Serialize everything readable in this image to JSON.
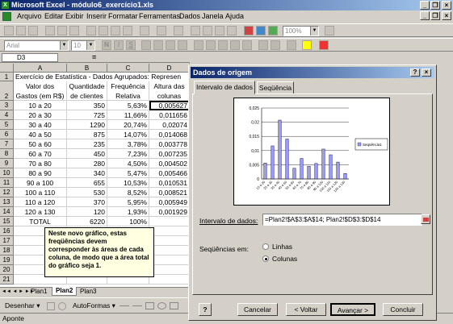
{
  "window": {
    "title": "Microsoft Excel - módulo6_exercício1.xls",
    "min": "_",
    "restore": "❐",
    "close": "×"
  },
  "menu": [
    "Arquivo",
    "Editar",
    "Exibir",
    "Inserir",
    "Formatar",
    "Ferramentas",
    "Dados",
    "Janela",
    "Ajuda"
  ],
  "toolbar": {
    "font": "Arial",
    "size": "10",
    "bold": "N",
    "italic": "I",
    "underline": "S",
    "zoom": "100%"
  },
  "formula_bar": {
    "cell": "D3",
    "eq": "="
  },
  "sheet": {
    "columns": [
      "A",
      "B",
      "C",
      "D"
    ],
    "title_row": "Exercício de Estatística - Dados Agrupados: Represen",
    "headers": {
      "a": [
        "Valor dos",
        "Gastos (em R$)"
      ],
      "b": [
        "Quantidade",
        "de clientes"
      ],
      "c": [
        "Frequência",
        "Relativa"
      ],
      "d": [
        "Altura das",
        "colunas"
      ]
    },
    "rows": [
      {
        "n": "3",
        "a": "10 a 20",
        "b": "350",
        "c": "5,63%",
        "d": "0,005627"
      },
      {
        "n": "4",
        "a": "20 a 30",
        "b": "725",
        "c": "11,66%",
        "d": "0,011656"
      },
      {
        "n": "5",
        "a": "30 a 40",
        "b": "1290",
        "c": "20,74%",
        "d": "0,02074"
      },
      {
        "n": "6",
        "a": "40 a 50",
        "b": "875",
        "c": "14,07%",
        "d": "0,014068"
      },
      {
        "n": "7",
        "a": "50 a 60",
        "b": "235",
        "c": "3,78%",
        "d": "0,003778"
      },
      {
        "n": "8",
        "a": "60 a 70",
        "b": "450",
        "c": "7,23%",
        "d": "0,007235"
      },
      {
        "n": "9",
        "a": "70 a 80",
        "b": "280",
        "c": "4,50%",
        "d": "0,004502"
      },
      {
        "n": "10",
        "a": "80 a 90",
        "b": "340",
        "c": "5,47%",
        "d": "0,005466"
      },
      {
        "n": "11",
        "a": "90 a 100",
        "b": "655",
        "c": "10,53%",
        "d": "0,010531"
      },
      {
        "n": "12",
        "a": "100 a 110",
        "b": "530",
        "c": "8,52%",
        "d": "0,008521"
      },
      {
        "n": "13",
        "a": "110 a 120",
        "b": "370",
        "c": "5,95%",
        "d": "0,005949"
      },
      {
        "n": "14",
        "a": "120 a 130",
        "b": "120",
        "c": "1,93%",
        "d": "0,001929"
      }
    ],
    "total_row": {
      "n": "15",
      "a": "TOTAL",
      "b": "6220",
      "c": "100%"
    },
    "empty_rows": [
      "16",
      "17",
      "18",
      "19",
      "20",
      "21"
    ],
    "row_numbers": {
      "r1": "1",
      "r2": "2"
    },
    "comment": "Neste novo gráfico, estas freqüências devem corresponder às áreas de cada coluna, de modo que a área total do gráfico seja 1.",
    "tabs": [
      "Plan1",
      "Plan2",
      "Plan3"
    ],
    "tab_nav": "◄◄ ◄ ► ►►"
  },
  "drawbar": {
    "draw": "Desenhar ▾",
    "autoformas": "AutoFormas ▾"
  },
  "status": "Aponte",
  "dialog": {
    "title": "Dados de origem",
    "help": "?",
    "close": "×",
    "tabs": [
      "Intervalo de dados",
      "Seqüência"
    ],
    "range_label": "Intervalo de dados:",
    "range_value": "=Plan2!$A$3:$A$14; Plan2!$D$3:$D$14",
    "series_in_label": "Seqüências em:",
    "radio_rows": "Linhas",
    "radio_cols": "Colunas",
    "buttons": {
      "help": "?",
      "cancel": "Cancelar",
      "back": "< Voltar",
      "next": "Avançar >",
      "finish": "Concluir"
    }
  },
  "chart_data": {
    "type": "bar",
    "categories": [
      "10 a 20",
      "20 a 30",
      "30 a 40",
      "40 a 50",
      "50 a 60",
      "60 a 70",
      "70 a 80",
      "80 a 90",
      "90 a 100",
      "100 a 110",
      "110 a 120",
      "120 a 130"
    ],
    "series": [
      {
        "name": "Seqüência1",
        "values": [
          0.005627,
          0.011656,
          0.02074,
          0.014068,
          0.003778,
          0.007235,
          0.004502,
          0.005466,
          0.010531,
          0.008521,
          0.005949,
          0.001929
        ]
      }
    ],
    "yticks": [
      "0",
      "0,005",
      "0,01",
      "0,015",
      "0,02",
      "0,025"
    ],
    "ylim": [
      0,
      0.025
    ],
    "legend": "right",
    "color": "#9999ff"
  }
}
